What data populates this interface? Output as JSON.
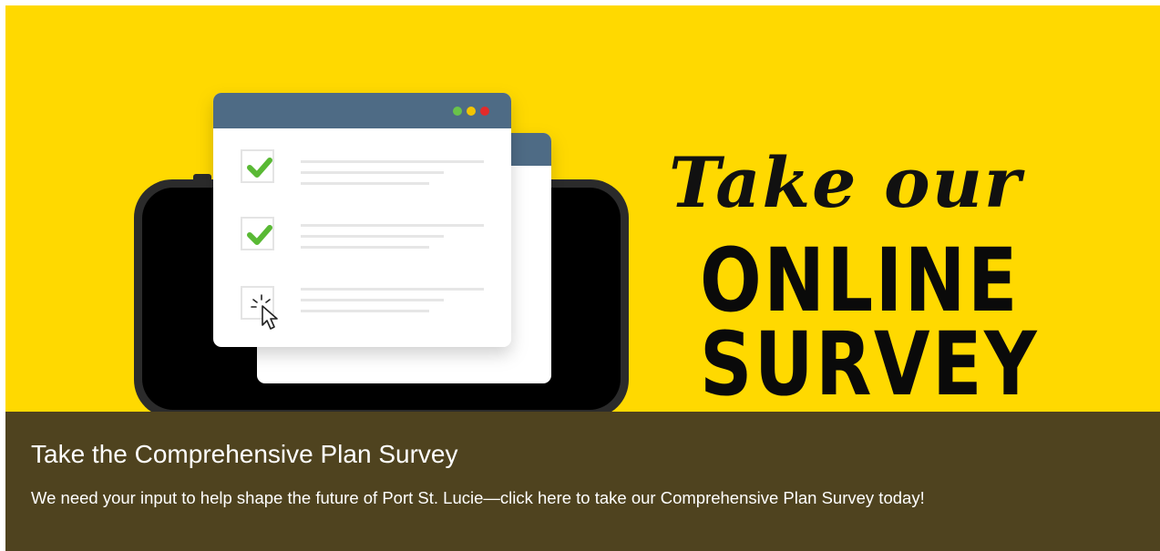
{
  "banner": {
    "script_line": "Take our",
    "headline_line1": "ONLINE",
    "headline_line2": "SURVEY",
    "background_color": "#ffd900",
    "illustration_icons": [
      "phone-icon",
      "survey-window-icon",
      "checkmark-icon",
      "pointer-cursor-icon"
    ],
    "window_dot_colors": [
      "#69c34a",
      "#f2c500",
      "#e22b2b"
    ]
  },
  "caption": {
    "title": "Take the Comprehensive Plan Survey",
    "description": "We need your input to help shape the future of Port St. Lucie—click here to take our Comprehensive Plan Survey today!",
    "background_color": "#4f431f"
  }
}
